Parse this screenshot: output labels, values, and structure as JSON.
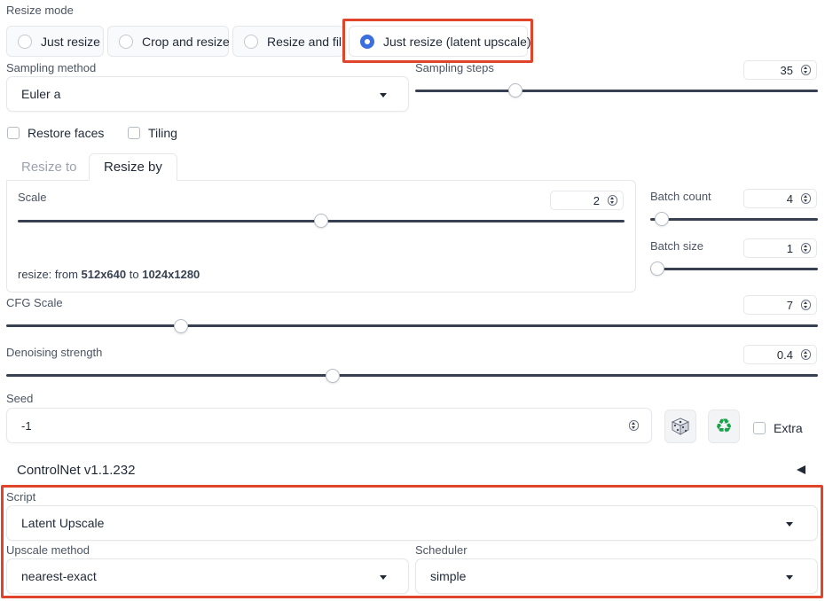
{
  "resize_mode": {
    "label": "Resize mode",
    "options": [
      "Just resize",
      "Crop and resize",
      "Resize and fill",
      "Just resize (latent upscale)"
    ],
    "selected": "Just resize (latent upscale)"
  },
  "sampling": {
    "method_label": "Sampling method",
    "method_value": "Euler a",
    "steps_label": "Sampling steps",
    "steps_value": "35",
    "steps_fraction": 0.24
  },
  "checkboxes": {
    "restore_faces": "Restore faces",
    "tiling": "Tiling"
  },
  "tabs": {
    "resize_to": "Resize to",
    "resize_by": "Resize by",
    "active": "Resize by"
  },
  "scale": {
    "label": "Scale",
    "value": "2",
    "fraction": 0.5,
    "info_prefix": "resize: from ",
    "info_from": "512x640",
    "info_mid": " to ",
    "info_to": "1024x1280"
  },
  "batch": {
    "count_label": "Batch count",
    "count_value": "4",
    "count_fraction": 0.03,
    "size_label": "Batch size",
    "size_value": "1",
    "size_fraction": 0.0
  },
  "cfg": {
    "label": "CFG Scale",
    "value": "7",
    "fraction": 0.21
  },
  "denoise": {
    "label": "Denoising strength",
    "value": "0.4",
    "fraction": 0.4
  },
  "seed": {
    "label": "Seed",
    "value": "-1",
    "dice_icon": "dice-icon",
    "recycle_icon": "recycle-icon",
    "extra_label": "Extra"
  },
  "controlnet": {
    "title": "ControlNet v1.1.232",
    "toggle_icon": "triangle-left-icon"
  },
  "script": {
    "label": "Script",
    "value": "Latent Upscale",
    "upscale_label": "Upscale method",
    "upscale_value": "nearest-exact",
    "scheduler_label": "Scheduler",
    "scheduler_value": "simple"
  },
  "colors": {
    "accent": "#3b6fe0",
    "highlight": "#e0452b",
    "track": "#374151"
  }
}
